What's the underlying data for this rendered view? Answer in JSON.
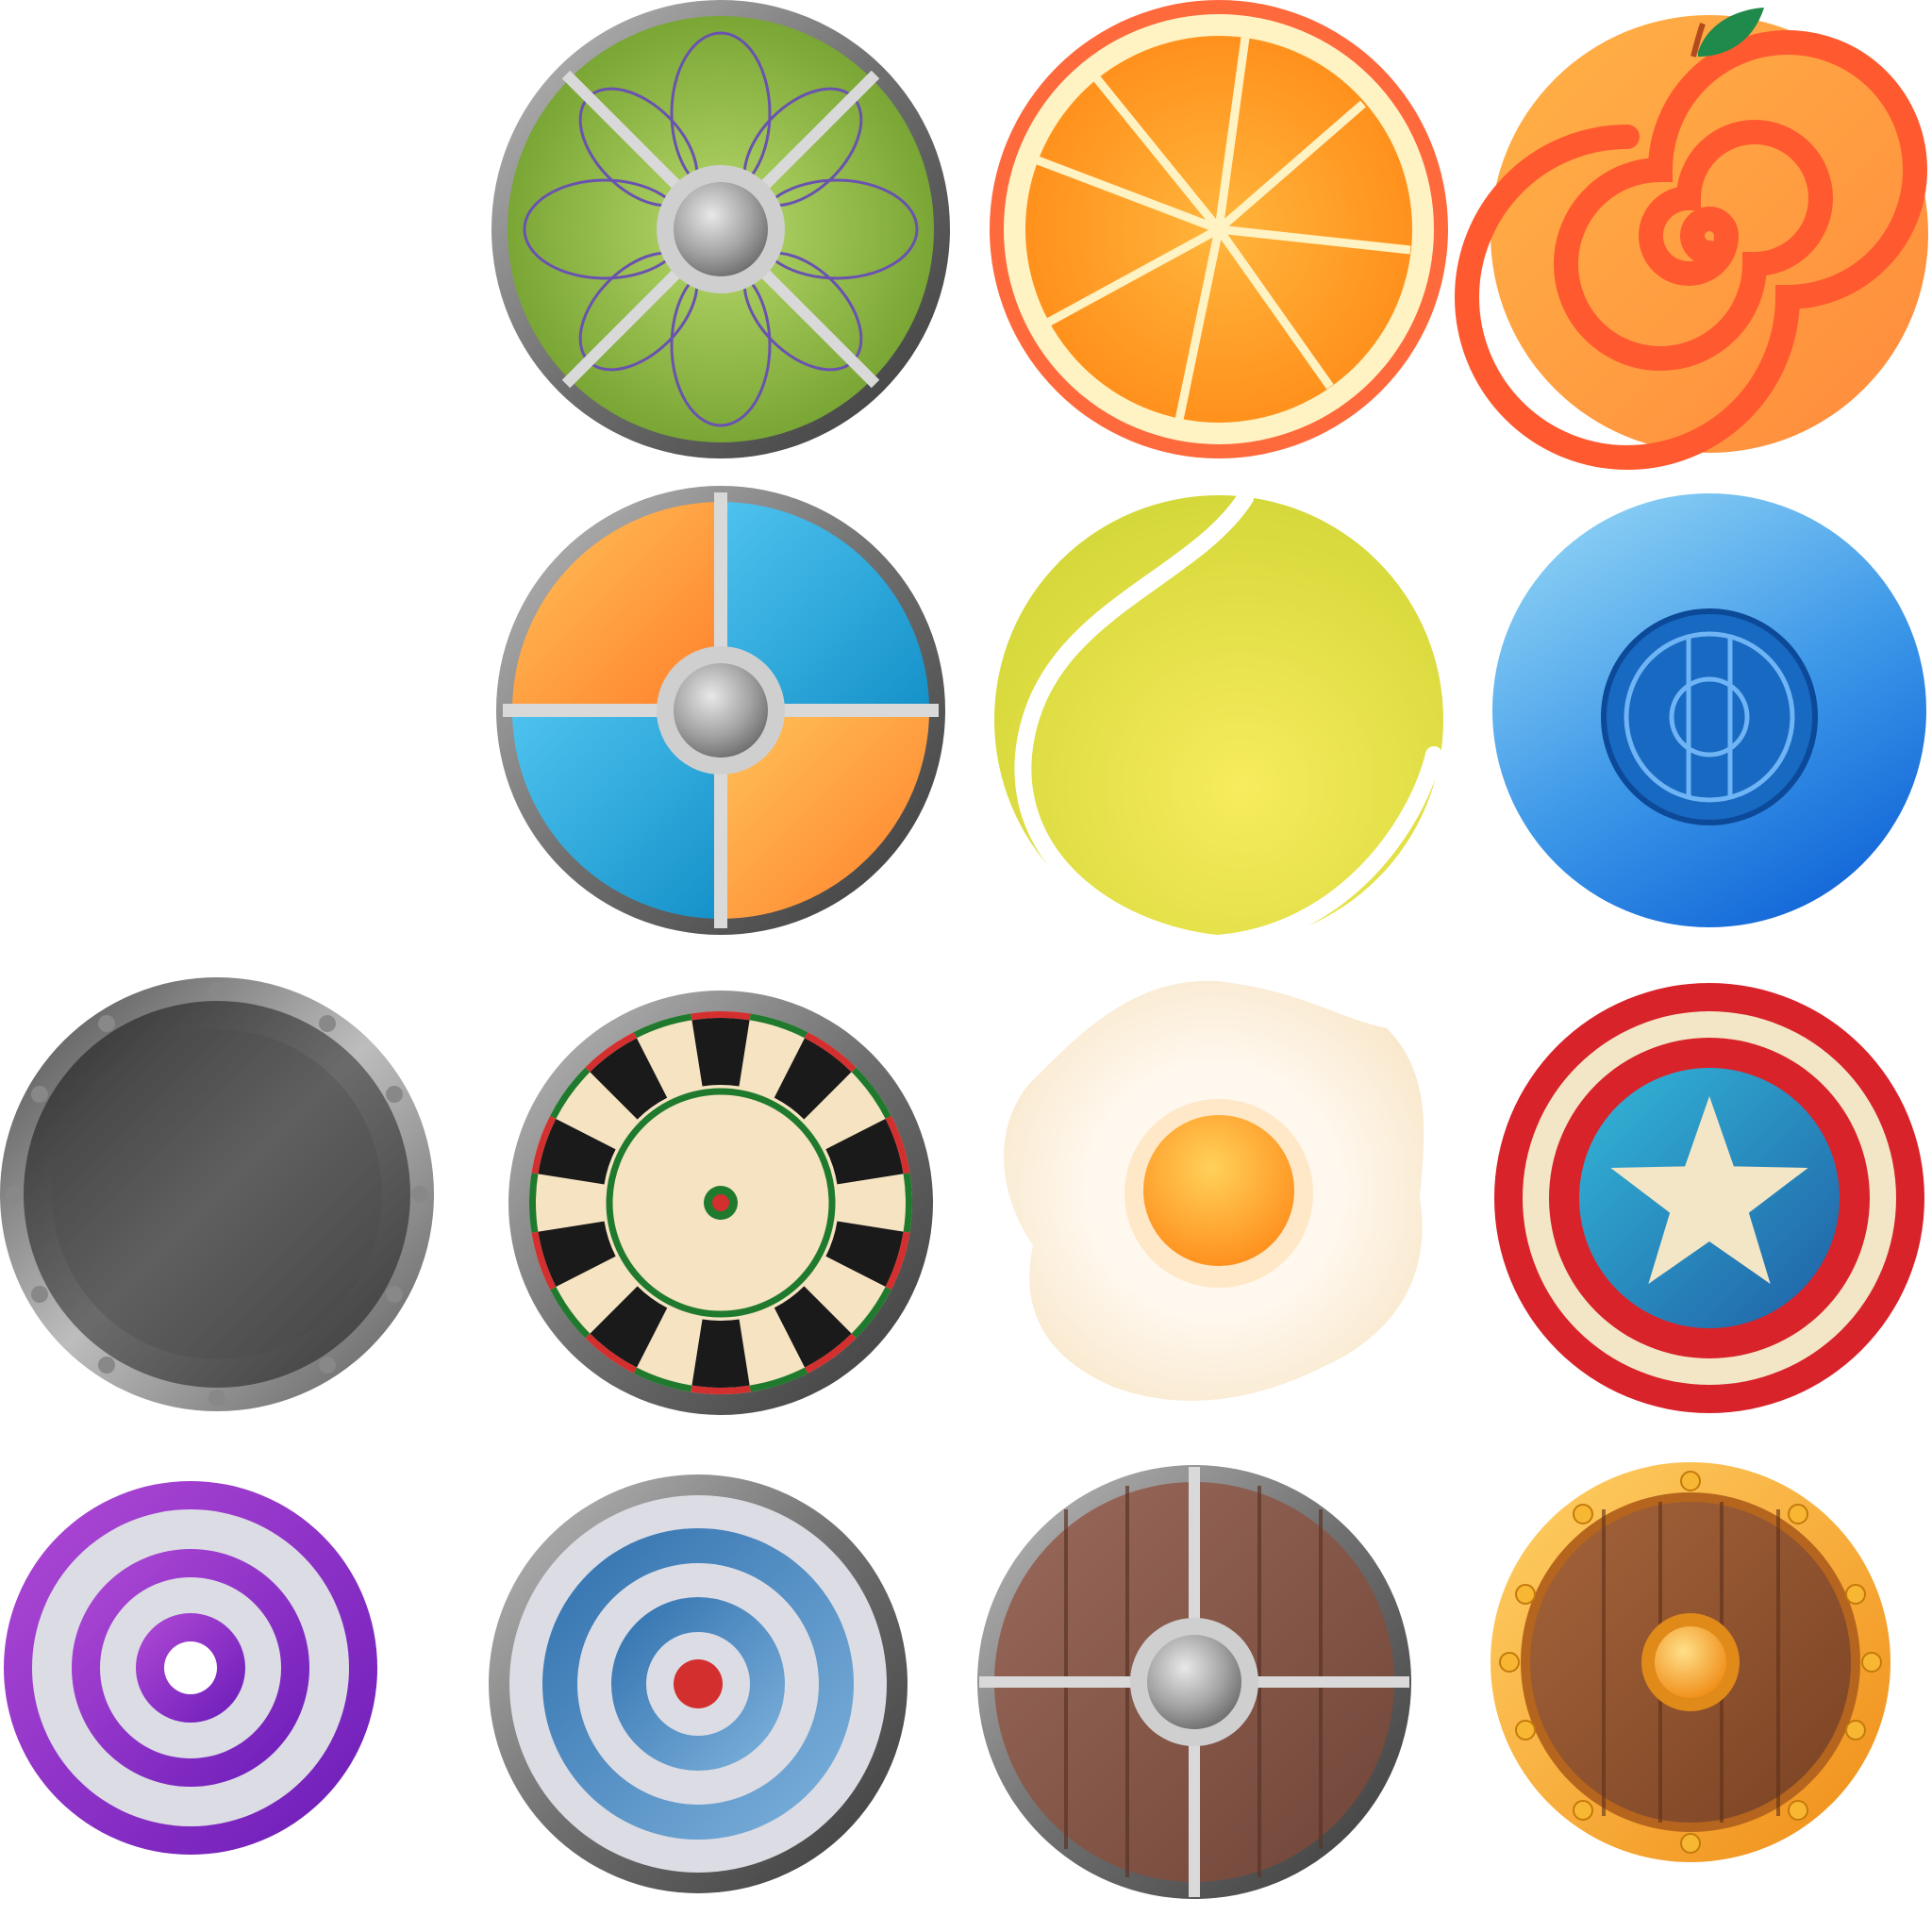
{
  "sheet": {
    "background": "#ffffff",
    "icons": [
      {
        "name": "green-viking-shield-icon",
        "kind": "viking-green",
        "accent": "#8db83a"
      },
      {
        "name": "orange-slice-icon",
        "kind": "orange-slice",
        "accent": "#ff9a1f"
      },
      {
        "name": "spiral-peach-icon",
        "kind": "peach-spiral",
        "accent": "#ff7a3c"
      },
      {
        "name": "quartered-orange-blue-shield-icon",
        "kind": "quarter-shield",
        "accent": "#29a9df"
      },
      {
        "name": "tennis-ball-icon",
        "kind": "tennis-ball",
        "accent": "#e3e44a"
      },
      {
        "name": "blue-disc-emblem-icon",
        "kind": "blue-disc",
        "accent": "#1f7fe0"
      },
      {
        "name": "riveted-steel-shield-icon",
        "kind": "steel-shield",
        "accent": "#5c5c5c"
      },
      {
        "name": "dartboard-icon",
        "kind": "dartboard",
        "accent": "#1a1a1a"
      },
      {
        "name": "fried-egg-icon",
        "kind": "fried-egg",
        "accent": "#ffb733"
      },
      {
        "name": "star-shield-icon",
        "kind": "star-shield",
        "accent": "#d8232a"
      },
      {
        "name": "purple-target-icon",
        "kind": "purple-target",
        "accent": "#8a2be2"
      },
      {
        "name": "blue-target-shield-icon",
        "kind": "blue-target",
        "accent": "#3d86c4"
      },
      {
        "name": "wooden-viking-shield-icon",
        "kind": "wood-shield",
        "accent": "#8a5a4c"
      },
      {
        "name": "golden-wooden-shield-icon",
        "kind": "gold-wood-shield",
        "accent": "#f5a623"
      }
    ]
  }
}
